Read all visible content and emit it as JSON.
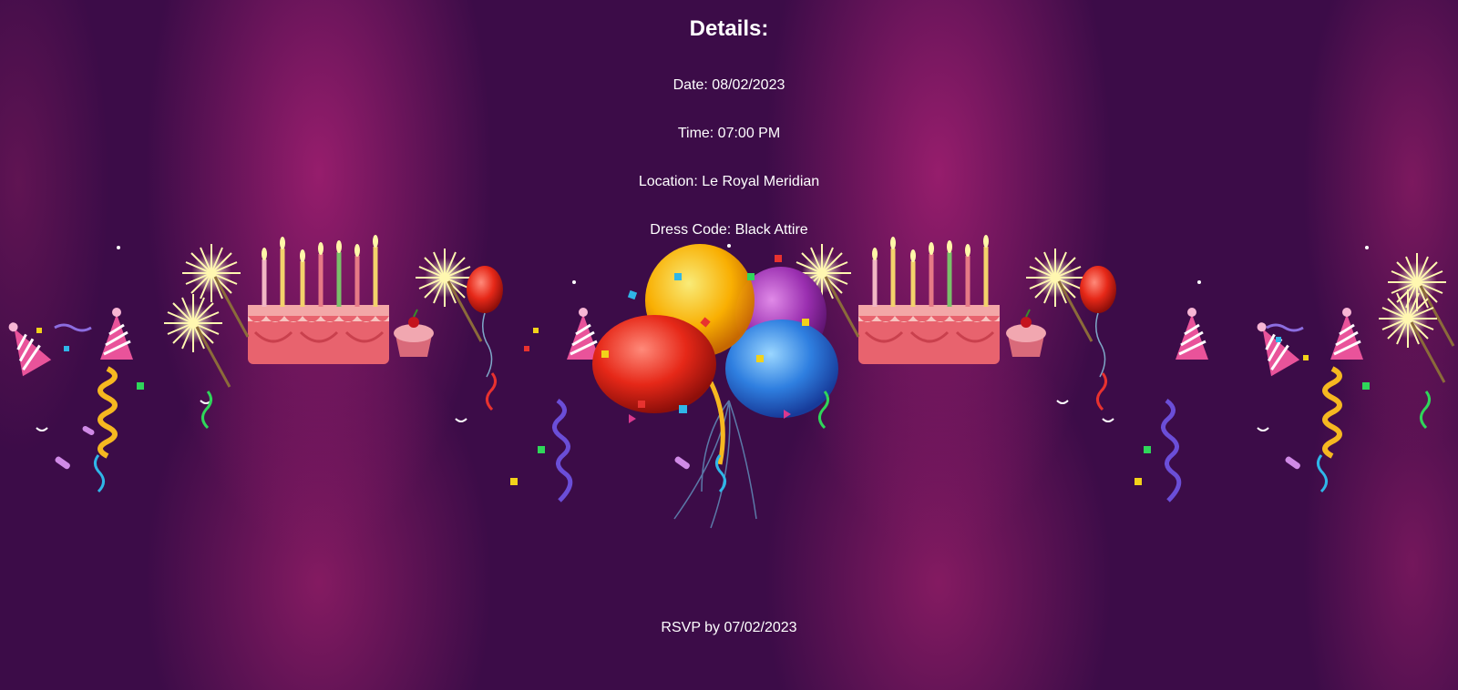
{
  "details": {
    "heading": "Details:",
    "date": "Date: 08/02/2023",
    "time": "Time: 07:00 PM",
    "location": "Location: Le Royal Meridian",
    "dress_code": "Dress Code: Black Attire"
  },
  "footer": {
    "rsvp": "RSVP by 07/02/2023"
  },
  "colors": {
    "background": "#3c0c48",
    "background_glow": "#9b1e6e",
    "text": "#ffffff"
  },
  "icons": [
    "birthday-cake-icon",
    "balloon-bunch-icon",
    "red-balloon-icon",
    "sparkler-icon",
    "party-hat-icon",
    "cupcake-icon",
    "streamer-icon",
    "confetti-icon"
  ]
}
